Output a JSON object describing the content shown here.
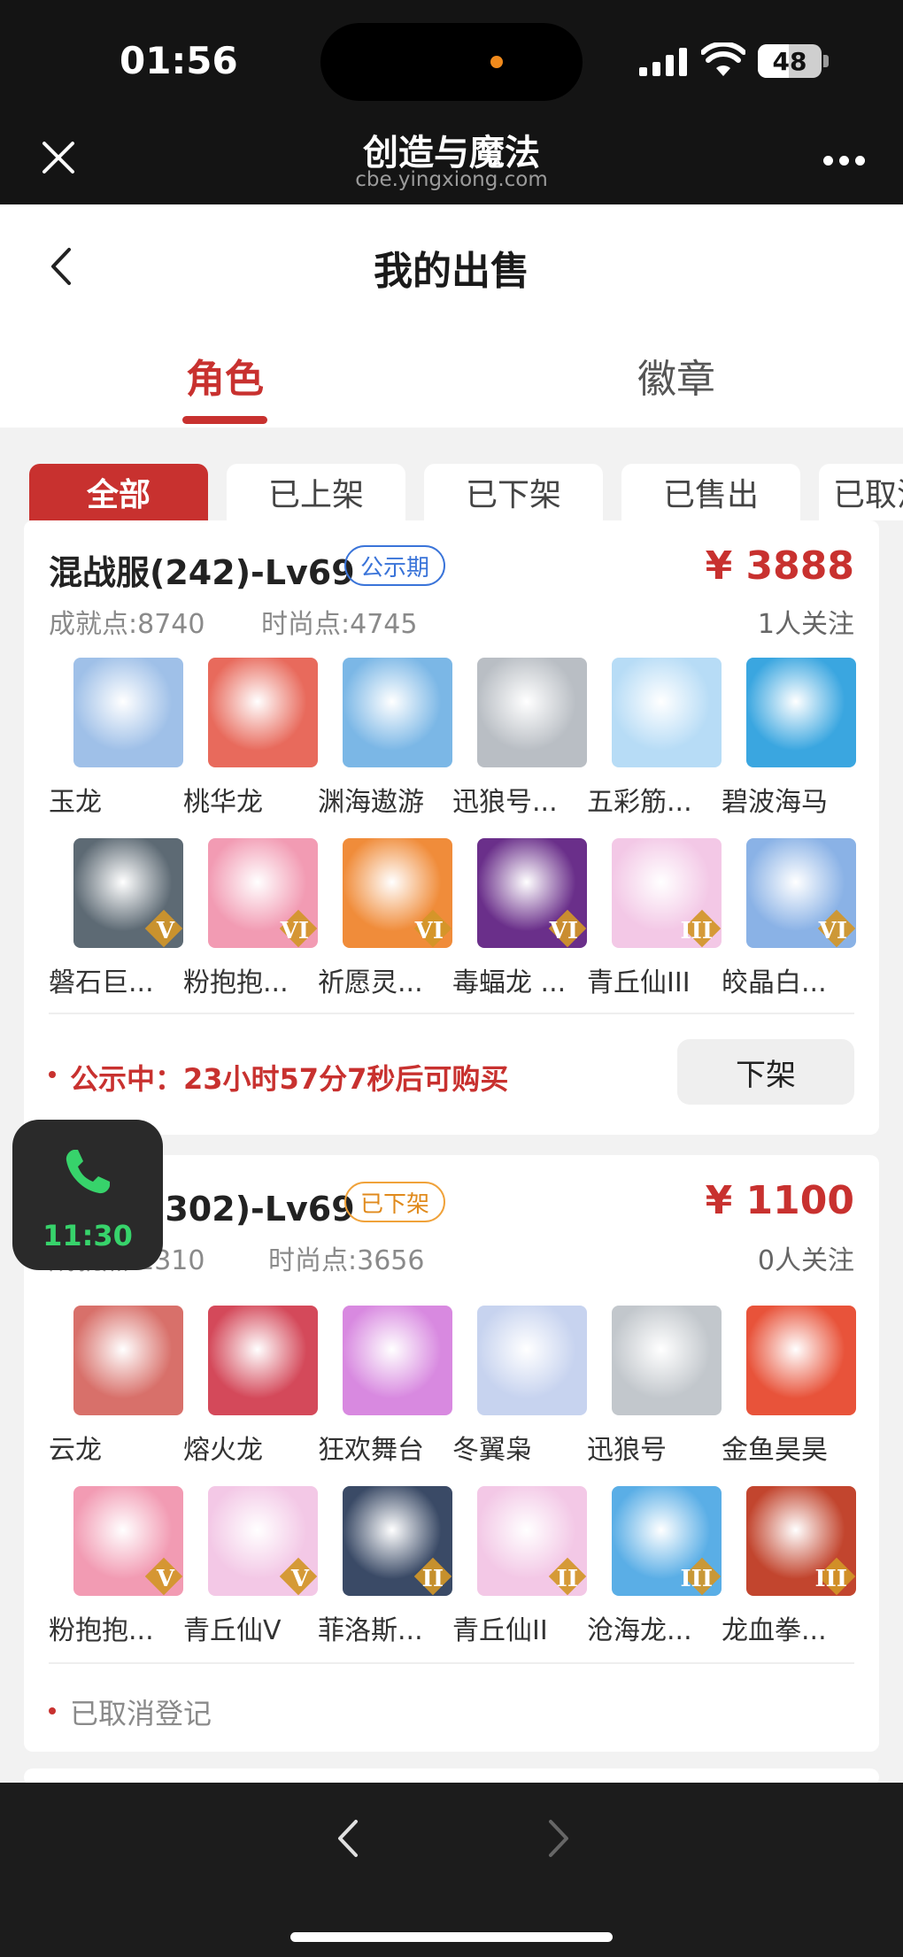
{
  "status_bar": {
    "time": "01:56",
    "battery": "48"
  },
  "browser": {
    "title": "创造与魔法",
    "url": "cbe.yingxiong.com"
  },
  "page": {
    "title": "我的出售"
  },
  "tabs": [
    {
      "label": "角色"
    },
    {
      "label": "徽章"
    }
  ],
  "filters": [
    {
      "label": "全部"
    },
    {
      "label": "已上架"
    },
    {
      "label": "已下架"
    },
    {
      "label": "已售出"
    },
    {
      "label": "已取消"
    }
  ],
  "listings": [
    {
      "server": "混战服(242)-Lv69",
      "status": "公示期",
      "price": "¥ 3888",
      "watchers": "1人关注",
      "achievement": "成就点:8740",
      "fashion": "时尚点:4745",
      "pets": [
        {
          "name": "玉龙",
          "color": "#9fc0e8"
        },
        {
          "name": "桃华龙",
          "color": "#e86a5c"
        },
        {
          "name": "渊海遨游",
          "color": "#7bb7e6"
        },
        {
          "name": "迅狼号...",
          "color": "#b9bec4"
        },
        {
          "name": "五彩筋...",
          "color": "#b7dcf6"
        },
        {
          "name": "碧波海马",
          "color": "#3aa6e0"
        },
        {
          "name": "磐石巨...",
          "color": "#5d6a74",
          "rank": "V"
        },
        {
          "name": "粉抱抱...",
          "color": "#f29bb3",
          "rank": "VI"
        },
        {
          "name": "祈愿灵...",
          "color": "#f08c3a",
          "rank": "VI"
        },
        {
          "name": "毒蝠龙 ...",
          "color": "#6a2f8a",
          "rank": "VI"
        },
        {
          "name": "青丘仙III",
          "color": "#f3c8e6",
          "rank": "III"
        },
        {
          "name": "皎晶白...",
          "color": "#8ab2e6",
          "rank": "VI"
        }
      ],
      "notice": "公示中：23小时57分7秒后可购买",
      "action": "下架"
    },
    {
      "server": "混战服(302)-Lv69",
      "status": "已下架",
      "price": "¥ 1100",
      "watchers": "0人关注",
      "achievement": "成就点:1310",
      "fashion": "时尚点:3656",
      "pets": [
        {
          "name": "云龙",
          "color": "#d8706a"
        },
        {
          "name": "熔火龙",
          "color": "#d4495a"
        },
        {
          "name": "狂欢舞台",
          "color": "#d889e0"
        },
        {
          "name": "冬翼枭",
          "color": "#c7d3ef"
        },
        {
          "name": "迅狼号",
          "color": "#c2c7cc"
        },
        {
          "name": "金鱼昊昊",
          "color": "#e8533a"
        },
        {
          "name": "粉抱抱...",
          "color": "#f29bb3",
          "rank": "V"
        },
        {
          "name": "青丘仙V",
          "color": "#f3c8e6",
          "rank": "V"
        },
        {
          "name": "菲洛斯...",
          "color": "#3a4a66",
          "rank": "II"
        },
        {
          "name": "青丘仙II",
          "color": "#f3c8e6",
          "rank": "II"
        },
        {
          "name": "沧海龙...",
          "color": "#5aaee6",
          "rank": "III"
        },
        {
          "name": "龙血拳...",
          "color": "#c2452e",
          "rank": "III"
        }
      ],
      "notice": "已取消登记"
    }
  ],
  "call_widget": {
    "time": "11:30"
  },
  "colors": {
    "accent": "#c8312f",
    "call_green": "#37d36b"
  }
}
